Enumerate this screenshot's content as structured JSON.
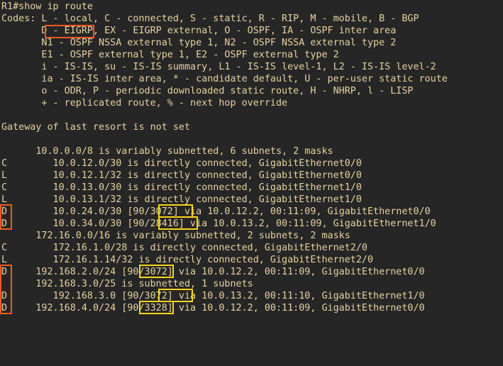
{
  "window": {
    "title": "R1#show ip route"
  },
  "colors": {
    "background": "#262626",
    "text": "#e6d2a0",
    "highlight_orange": "#f05a23",
    "highlight_yellow": "#f8d41c"
  },
  "terminal": {
    "lines": [
      "R1#show ip route",
      "Codes: L - local, C - connected, S - static, R - RIP, M - mobile, B - BGP",
      "       D - EIGRP, EX - EIGRP external, O - OSPF, IA - OSPF inter area",
      "       N1 - OSPF NSSA external type 1, N2 - OSPF NSSA external type 2",
      "       E1 - OSPF external type 1, E2 - OSPF external type 2",
      "       i - IS-IS, su - IS-IS summary, L1 - IS-IS level-1, L2 - IS-IS level-2",
      "       ia - IS-IS inter area, * - candidate default, U - per-user static route",
      "       o - ODR, P - periodic downloaded static route, H - NHRP, l - LISP",
      "       + - replicated route, % - next hop override",
      "",
      "Gateway of last resort is not set",
      "",
      "      10.0.0.0/8 is variably subnetted, 6 subnets, 2 masks",
      "C        10.0.12.0/30 is directly connected, GigabitEthernet0/0",
      "L        10.0.12.1/32 is directly connected, GigabitEthernet0/0",
      "C        10.0.13.0/30 is directly connected, GigabitEthernet1/0",
      "L        10.0.13.1/32 is directly connected, GigabitEthernet1/0",
      "D        10.0.24.0/30 [90/3072] via 10.0.12.2, 00:11:09, GigabitEthernet0/0",
      "D        10.0.34.0/30 [90/28416] via 10.0.13.2, 00:11:09, GigabitEthernet1/0",
      "      172.16.0.0/16 is variably subnetted, 2 subnets, 2 masks",
      "C        172.16.1.0/28 is directly connected, GigabitEthernet2/0",
      "L        172.16.1.14/32 is directly connected, GigabitEthernet2/0",
      "D     192.168.2.0/24 [90/3072] via 10.0.12.2, 00:11:09, GigabitEthernet0/0",
      "      192.168.3.0/25 is subnetted, 1 subnets",
      "D        192.168.3.0 [90/3072] via 10.0.13.2, 00:11:10, GigabitEthernet1/0",
      "D     192.168.4.0/24 [90/3328] via 10.0.12.2, 00:11:09, GigabitEthernet0/0"
    ]
  }
}
